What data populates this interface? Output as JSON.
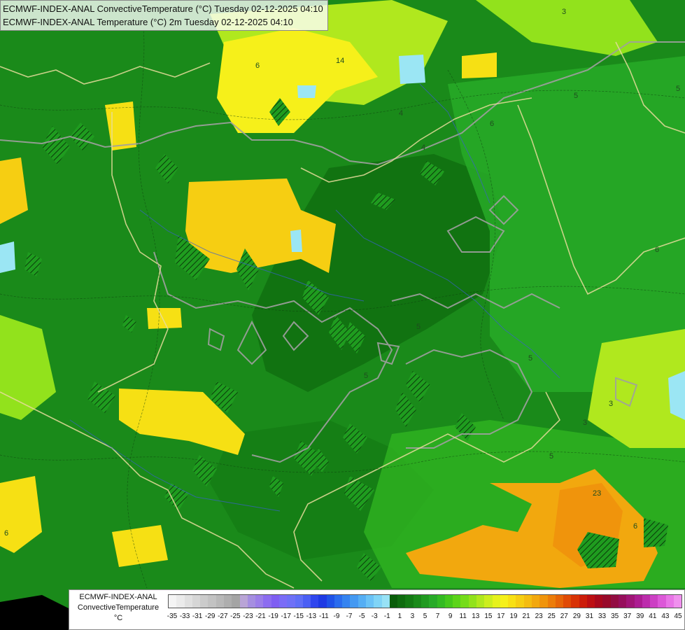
{
  "title": {
    "line1": "ECMWF-INDEX-ANAL ConvectiveTemperature (°C) Tuesday 02-12-2025 04:10",
    "line2": "ECMWF-INDEX-ANAL Temperature (°C) 2m Tuesday 02-12-2025 04:10"
  },
  "legend": {
    "label_line1": "ECMWF-INDEX-ANAL",
    "label_line2": "ConvectiveTemperature",
    "label_line3": "°C",
    "ticks": [
      "-35",
      "-33",
      "-31",
      "-29",
      "-27",
      "-25",
      "-23",
      "-21",
      "-19",
      "-17",
      "-15",
      "-13",
      "-11",
      "-9",
      "-7",
      "-5",
      "-3",
      "-1",
      "1",
      "3",
      "5",
      "7",
      "9",
      "11",
      "13",
      "15",
      "17",
      "19",
      "21",
      "23",
      "25",
      "27",
      "29",
      "31",
      "33",
      "35",
      "37",
      "39",
      "41",
      "43",
      "45"
    ],
    "colors": [
      "#f4f4f4",
      "#ebebeb",
      "#e0e0e0",
      "#d6d6d6",
      "#cbcbcb",
      "#c2c2c2",
      "#b8b8b8",
      "#aeaeae",
      "#a4a4a4",
      "#b9a4d6",
      "#a58ee0",
      "#9b7ee8",
      "#8c6cf0",
      "#7f5ef2",
      "#7a6cf6",
      "#6e70f6",
      "#5f6ef6",
      "#4a5ef4",
      "#2f46ee",
      "#1e3ae4",
      "#1f52e8",
      "#2a6cee",
      "#3583f0",
      "#4499f2",
      "#55aef4",
      "#6ac2f6",
      "#80d4f6",
      "#98e2f6",
      "#0a5c0a",
      "#0f6b0f",
      "#147a14",
      "#1a8a1a",
      "#209a20",
      "#28aa28",
      "#33ba22",
      "#45c81c",
      "#5cd41a",
      "#75dc1a",
      "#92e21c",
      "#b0e81e",
      "#ccee1e",
      "#e6f21c",
      "#f6f01a",
      "#f8e014",
      "#f6ce12",
      "#f4bc10",
      "#f2a80e",
      "#f0940c",
      "#ec7c0a",
      "#e66408",
      "#e04a06",
      "#d83206",
      "#cc1c0a",
      "#bc0e12",
      "#a8081c",
      "#980a2a",
      "#920c42",
      "#960e5c",
      "#a01476",
      "#ac1c92",
      "#bc2cac",
      "#cc40c4",
      "#dc58d8",
      "#e874e6",
      "#f090ee"
    ]
  },
  "contour_labels": [
    "6",
    "5",
    "4",
    "4",
    "14",
    "5",
    "6",
    "5",
    "3",
    "5",
    "3",
    "23",
    "6",
    "6",
    "6",
    "5",
    "5",
    "3"
  ],
  "colors": {
    "base_green": "#1a8a1a",
    "dark_green": "#0f6b0f",
    "mid_green": "#28aa28",
    "bright_green": "#45c81c",
    "yellow_green": "#b0e81e",
    "yellow": "#f6ce12",
    "light_yellow": "#f6f01a",
    "orange": "#f2a80e",
    "light_blue": "#9be6f4",
    "border_gray": "#a0a0a0",
    "border_beige": "#e8dc9c",
    "river_blue": "#3a5fcf"
  }
}
